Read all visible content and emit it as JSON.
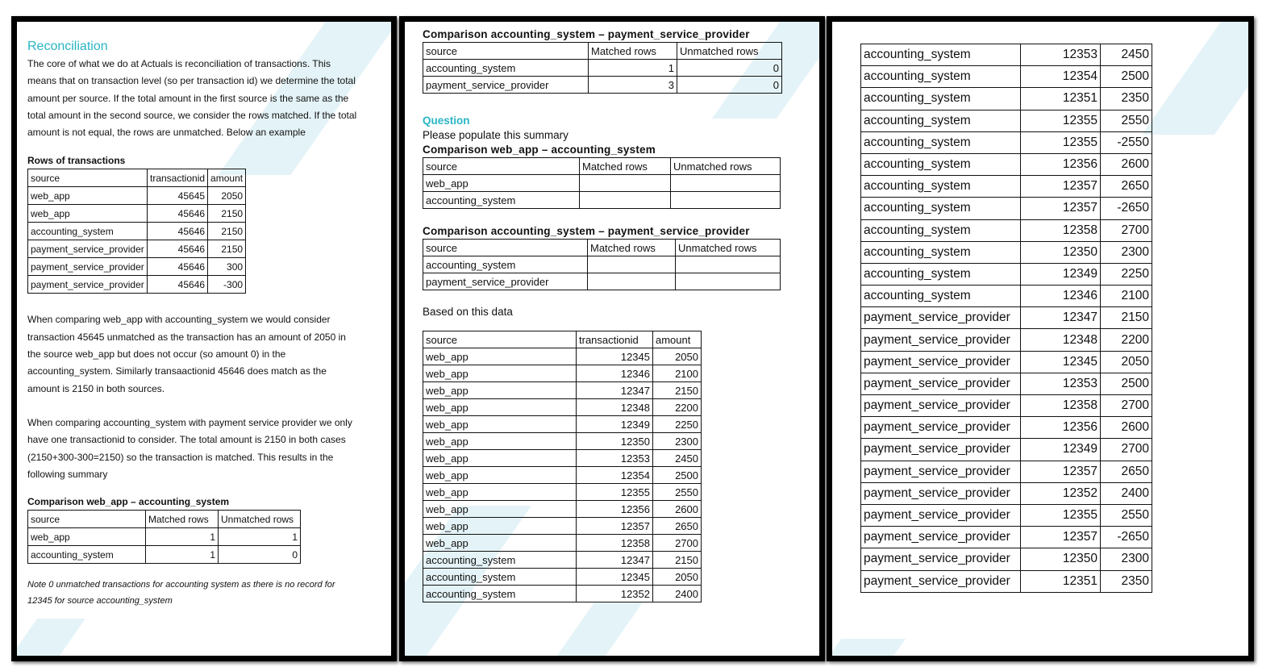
{
  "page1": {
    "title": "Reconciliation",
    "intro": "The core of what we do at Actuals is reconciliation of transactions. This means that on transaction level (so per transaction id) we determine the total amount per source. If the total amount in the first source is the same as the total amount in the second source, we consider the rows matched. If the total amount is not equal, the rows are unmatched. Below an example",
    "rows_heading": "Rows of transactions",
    "rows_header": [
      "source",
      "transactionid",
      "amount"
    ],
    "rows": [
      [
        "web_app",
        "45645",
        "2050"
      ],
      [
        "web_app",
        "45646",
        "2150"
      ],
      [
        "accounting_system",
        "45646",
        "2150"
      ],
      [
        "payment_service_provider",
        "45646",
        "2150"
      ],
      [
        "payment_service_provider",
        "45646",
        "300"
      ],
      [
        "payment_service_provider",
        "45646",
        "-300"
      ]
    ],
    "para2": "When comparing web_app with accounting_system we would consider transaction 45645 unmatched as the transaction has an amount of 2050 in the source web_app but does not occur (so amount 0) in the accounting_system. Similarly transaactionid 45646 does match as the amount is 2150 in both sources.",
    "para3": "When comparing accounting_system with payment service provider we only have one transactionid to consider. The total amount is 2150 in both cases (2150+300-300=2150) so the transaction is matched. This results in the following summary",
    "comp_heading": "Comparison web_app – accounting_system",
    "comp_header": [
      "source",
      "Matched rows",
      "Unmatched rows"
    ],
    "comp_rows": [
      [
        "web_app",
        "1",
        "1"
      ],
      [
        "accounting_system",
        "1",
        "0"
      ]
    ],
    "note": "Note 0 unmatched transactions for accounting system as there is no record for 12345 for source accounting_system"
  },
  "page2": {
    "comp_heading": "Comparison accounting_system – payment_service_provider",
    "comp_header": [
      "source",
      "Matched rows",
      "Unmatched rows"
    ],
    "comp_rows": [
      [
        "accounting_system",
        "1",
        "0"
      ],
      [
        "payment_service_provider",
        "3",
        "0"
      ]
    ],
    "question_label": "Question",
    "question_text": "Please populate this summary",
    "q1_heading": "Comparison web_app – accounting_system",
    "q1_header": [
      "source",
      "Matched rows",
      "Unmatched rows"
    ],
    "q1_rows": [
      [
        "web_app",
        "",
        ""
      ],
      [
        "accounting_system",
        "",
        ""
      ]
    ],
    "q2_heading": "Comparison accounting_system – payment_service_provider",
    "q2_header": [
      "source",
      "Matched rows",
      "Unmatched rows"
    ],
    "q2_rows": [
      [
        "accounting_system",
        "",
        ""
      ],
      [
        "payment_service_provider",
        "",
        ""
      ]
    ],
    "based_text": "Based on this data",
    "data_header": [
      "source",
      "transactionid",
      "amount"
    ],
    "data_rows": [
      [
        "web_app",
        "12345",
        "2050"
      ],
      [
        "web_app",
        "12346",
        "2100"
      ],
      [
        "web_app",
        "12347",
        "2150"
      ],
      [
        "web_app",
        "12348",
        "2200"
      ],
      [
        "web_app",
        "12349",
        "2250"
      ],
      [
        "web_app",
        "12350",
        "2300"
      ],
      [
        "web_app",
        "12353",
        "2450"
      ],
      [
        "web_app",
        "12354",
        "2500"
      ],
      [
        "web_app",
        "12355",
        "2550"
      ],
      [
        "web_app",
        "12356",
        "2600"
      ],
      [
        "web_app",
        "12357",
        "2650"
      ],
      [
        "web_app",
        "12358",
        "2700"
      ],
      [
        "accounting_system",
        "12347",
        "2150"
      ],
      [
        "accounting_system",
        "12345",
        "2050"
      ],
      [
        "accounting_system",
        "12352",
        "2400"
      ]
    ]
  },
  "page3": {
    "data_rows": [
      [
        "accounting_system",
        "12353",
        "2450"
      ],
      [
        "accounting_system",
        "12354",
        "2500"
      ],
      [
        "accounting_system",
        "12351",
        "2350"
      ],
      [
        "accounting_system",
        "12355",
        "2550"
      ],
      [
        "accounting_system",
        "12355",
        "-2550"
      ],
      [
        "accounting_system",
        "12356",
        "2600"
      ],
      [
        "accounting_system",
        "12357",
        "2650"
      ],
      [
        "accounting_system",
        "12357",
        "-2650"
      ],
      [
        "accounting_system",
        "12358",
        "2700"
      ],
      [
        "accounting_system",
        "12350",
        "2300"
      ],
      [
        "accounting_system",
        "12349",
        "2250"
      ],
      [
        "accounting_system",
        "12346",
        "2100"
      ],
      [
        "payment_service_provider",
        "12347",
        "2150"
      ],
      [
        "payment_service_provider",
        "12348",
        "2200"
      ],
      [
        "payment_service_provider",
        "12345",
        "2050"
      ],
      [
        "payment_service_provider",
        "12353",
        "2500"
      ],
      [
        "payment_service_provider",
        "12358",
        "2700"
      ],
      [
        "payment_service_provider",
        "12356",
        "2600"
      ],
      [
        "payment_service_provider",
        "12349",
        "2700"
      ],
      [
        "payment_service_provider",
        "12357",
        "2650"
      ],
      [
        "payment_service_provider",
        "12352",
        "2400"
      ],
      [
        "payment_service_provider",
        "12355",
        "2550"
      ],
      [
        "payment_service_provider",
        "12357",
        "-2650"
      ],
      [
        "payment_service_provider",
        "12350",
        "2300"
      ],
      [
        "payment_service_provider",
        "12351",
        "2350"
      ]
    ]
  },
  "colors": {
    "accent": "#29b5c4",
    "deco": "#e4f3f7"
  }
}
